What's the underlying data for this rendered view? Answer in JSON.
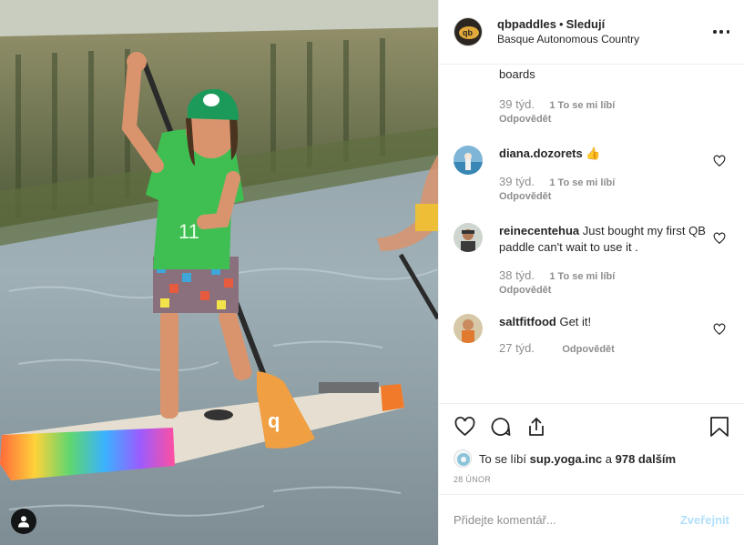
{
  "post": {
    "author": "qbpaddles",
    "separator": "•",
    "follow_label": "Sledují",
    "location": "Basque Autonomous Country"
  },
  "comments": [
    {
      "user": "",
      "text": "boards",
      "time": "39 týd.",
      "likes": "1 To se mi líbí",
      "reply": "Odpovědět"
    },
    {
      "user": "diana.dozorets",
      "text": "👍",
      "time": "39 týd.",
      "likes": "1 To se mi líbí",
      "reply": "Odpovědět"
    },
    {
      "user": "reinecentehua",
      "text": "Just bought my first QB paddle can't wait to use it .",
      "time": "38 týd.",
      "likes": "1 To se mi líbí",
      "reply": "Odpovědět"
    },
    {
      "user": "saltfitfood",
      "text": "Get it!",
      "time": "27 týd.",
      "likes": "",
      "reply": "Odpovědět"
    }
  ],
  "likes": {
    "prefix": "To se líbí",
    "user": "sup.yoga.inc",
    "middle": "a",
    "count": "978 dalším"
  },
  "date": "28 ÚNOR",
  "add_comment": {
    "placeholder": "Přidejte komentář...",
    "post_label": "Zveřejnit"
  },
  "colors": {
    "text": "#262626",
    "secondary": "#8e8e8e",
    "border": "#efefef",
    "post_disabled": "#b2dffc"
  },
  "icons": [
    "user-tag-icon",
    "more-options-icon",
    "heart-icon",
    "comment-icon",
    "share-icon",
    "bookmark-icon"
  ]
}
